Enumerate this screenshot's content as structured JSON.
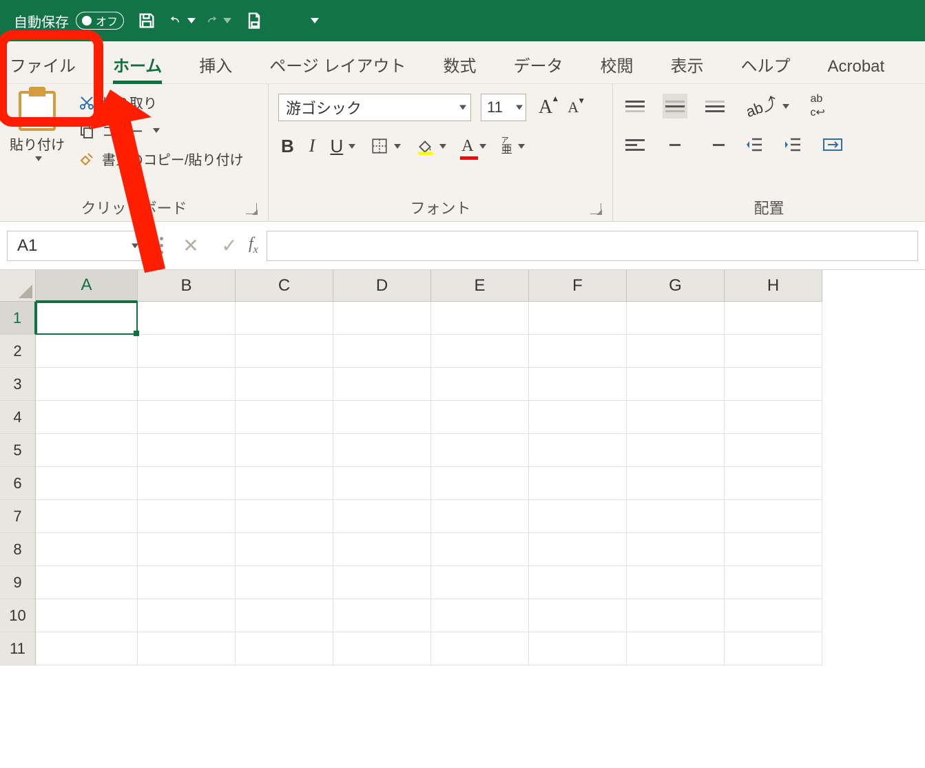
{
  "titlebar": {
    "autosave_label": "自動保存",
    "autosave_state": "オフ"
  },
  "tabs": [
    {
      "id": "file",
      "label": "ファイル"
    },
    {
      "id": "home",
      "label": "ホーム",
      "active": true
    },
    {
      "id": "insert",
      "label": "挿入"
    },
    {
      "id": "pagelayout",
      "label": "ページ レイアウト"
    },
    {
      "id": "formulas",
      "label": "数式"
    },
    {
      "id": "data",
      "label": "データ"
    },
    {
      "id": "review",
      "label": "校閲"
    },
    {
      "id": "view",
      "label": "表示"
    },
    {
      "id": "help",
      "label": "ヘルプ"
    },
    {
      "id": "acrobat",
      "label": "Acrobat"
    }
  ],
  "ribbon": {
    "clipboard": {
      "paste_label": "貼り付け",
      "cut_label": "切り取り",
      "copy_label": "コピー",
      "format_painter_label": "書式のコピー/貼り付け",
      "group_label": "クリップボード"
    },
    "font": {
      "font_name": "游ゴシック",
      "font_size": "11",
      "bold": "B",
      "italic": "I",
      "underline": "U",
      "phonetic_label": "ア亜",
      "group_label": "フォント"
    },
    "alignment": {
      "wrap_label": "abc折り返し",
      "merge_label": "セルを結合",
      "group_label": "配置"
    }
  },
  "namebox": {
    "value": "A1"
  },
  "formula_bar": {
    "value": ""
  },
  "grid": {
    "columns": [
      "A",
      "B",
      "C",
      "D",
      "E",
      "F",
      "G",
      "H"
    ],
    "rows": [
      "1",
      "2",
      "3",
      "4",
      "5",
      "6",
      "7",
      "8",
      "9",
      "10",
      "11"
    ],
    "selected_cell": "A1"
  }
}
